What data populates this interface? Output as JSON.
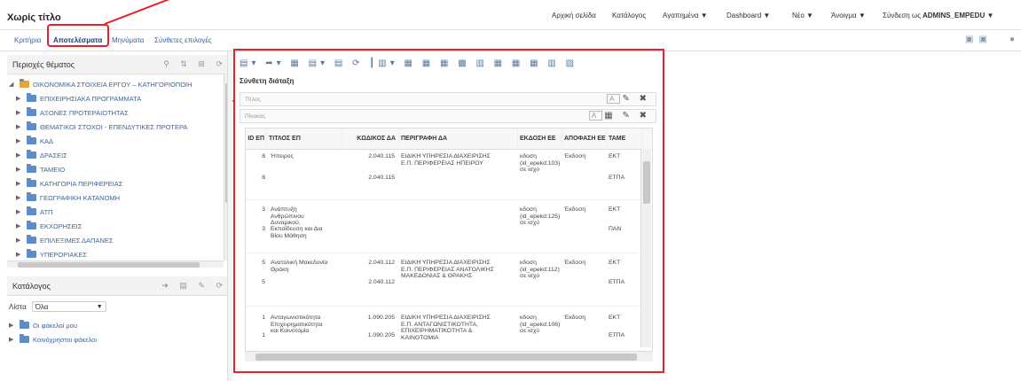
{
  "header": {
    "title": "Χωρίς τίτλο",
    "nav": [
      "Αρχική σελίδα",
      "Κατάλογος",
      "Αγαπημένα ▼",
      "Dashboard ▼",
      "Νέο ▼",
      "Άνοιγμα ▼",
      "Σύνδεση ως",
      "ADMINS_EMPEDU ▼"
    ]
  },
  "tabs": [
    "Κριτήρια",
    "Αποτελέσματα",
    "Μηνύματα",
    "Σύνθετες επιλογές"
  ],
  "subject_areas": {
    "title": "Περιοχές θέματος",
    "root": "ΟΙΚΟΝΟΜΙΚΑ ΣΤΟΙΧΕΙΑ ΕΡΓΟΥ – ΚΑΤΗΓΟΡΙΟΠΟΙΗ",
    "items": [
      "ΕΠΙΧΕΙΡΗΣΙΑΚΑ ΠΡΟΓΡΑΜΜΑΤΑ",
      "ΑΞΟΝΕΣ ΠΡΟΤΕΡΑΙΟΤΗΤΑΣ",
      "ΘΕΜΑΤΙΚΟΙ ΣΤΟΧΟΙ - ΕΠΕΝΔΥΤΙΚΕΣ ΠΡΟΤΕΡΑ",
      "ΚΑΔ",
      "ΔΡΑΣΕΙΣ",
      "ΤΑΜΕΙΟ",
      "ΚΑΤΗΓΟΡΙΑ ΠΕΡΙΦΕΡΕΙΑΣ",
      "ΓΕΩΓΡΑΦΙΚΗ ΚΑΤΑΝΟΜΗ",
      "ΑΤΠ",
      "ΕΚΧΩΡΗΣΕΙΣ",
      "ΕΠΙΛΕΞΙΜΕΣ ΔΑΠΑΝΕΣ",
      "ΥΠΕΡΟΡΙΑΚΕΣ"
    ]
  },
  "catalog": {
    "title": "Κατάλογος",
    "list_label": "Λίστα",
    "list_value": "Όλα",
    "folders": [
      "Οι φάκελοί μου",
      "Κοινόχρηστοι φάκελοι"
    ]
  },
  "results": {
    "compound_title": "Σύνθετη διάταξη",
    "title_view_label": "Τίτλος",
    "table_view_label": "Πίνακας",
    "columns": [
      "ID ΕΠ",
      "ΤΙΤΛΟΣ ΕΠ",
      "ΚΩΔΙΚΟΣ ΔΑ",
      "ΠΕΡΙΓΡΑΦΗ ΔΑ",
      "ΕΚΔΟΣΗ ΕΕ",
      "ΑΠΟΦΑΣΗ ΕΕ",
      "ΤΑΜΕ"
    ],
    "rows": [
      {
        "id": "8",
        "title": "Ήπειρος",
        "code": "2.040.115",
        "desc": "ΕΙΔΙΚΗ ΥΠΗΡΕΣΙΑ ΔΙΑΧΕΙΡΙΣΗΣ\nΕ.Π. ΠΕΡΙΦΕΡΕΙΑΣ ΗΠΕΙΡΟΥ",
        "issue": "κδοση\n(id_epekd:103)\nσε ισχύ",
        "dec": "Έκδοση",
        "fund": "ΕΚΤ"
      },
      {
        "id": "8",
        "title": "",
        "code": "2.040.115",
        "desc": "",
        "issue": "",
        "dec": "",
        "fund": "ΕΤΠΑ"
      },
      {
        "id": "3",
        "title": "Ανάπτυξη\nΑνθρώπινου\nΔυναμικού,",
        "code": "",
        "desc": "",
        "issue": "κδοση\n(id_epekd:125)\nσε ισχύ",
        "dec": "Έκδοση",
        "fund": "ΕΚΤ"
      },
      {
        "id": "3",
        "title": "Εκπαίδευση και Δια\nΒίου Μάθηση",
        "code": "",
        "desc": "",
        "issue": "",
        "dec": "",
        "fund": "ΠΑΝ"
      },
      {
        "id": "5",
        "title": "Ανατολική Μακεδονία\nΘράκη",
        "code": "2.040.112",
        "desc": "ΕΙΔΙΚΗ ΥΠΗΡΕΣΙΑ ΔΙΑΧΕΙΡΙΣΗΣ\nΕ.Π. ΠΕΡΙΦΕΡΕΙΑΣ ΑΝΑΤΟΛΙΚΗΣ\nΜΑΚΕΔΟΝΙΑΣ & ΘΡΑΚΗΣ",
        "issue": "κδοση\n(id_epekd:112)\nσε ισχύ",
        "dec": "Έκδοση",
        "fund": "ΕΚΤ"
      },
      {
        "id": "5",
        "title": "",
        "code": "2.040.112",
        "desc": "",
        "issue": "",
        "dec": "",
        "fund": "ΕΤΠΑ"
      },
      {
        "id": "1",
        "title": "Ανταγωνιστικότητα\nΕπιχειρηματικότητα\nκαι Καινοτομία",
        "code": "1.090.205",
        "desc": "ΕΙΔΙΚΗ ΥΠΗΡΕΣΙΑ ΔΙΑΧΕΙΡΙΣΗΣ\nΕ.Π. ΑΝΤΑΓΩΝΙΣΤΙΚΟΤΗΤΑ,\nΕΠΙΧΕΙΡΗΜΑΤΙΚΟΤΗΤΑ &\nΚΑΙΝΟΤΟΜΙΑ",
        "issue": "κδοση\n(id_epekd:106)\nσε ισχύ",
        "dec": "Έκδοση",
        "fund": "ΕΚΤ"
      },
      {
        "id": "1",
        "title": "",
        "code": "1.090.205",
        "desc": "",
        "issue": "",
        "dec": "",
        "fund": "ΕΤΠΑ"
      }
    ]
  }
}
